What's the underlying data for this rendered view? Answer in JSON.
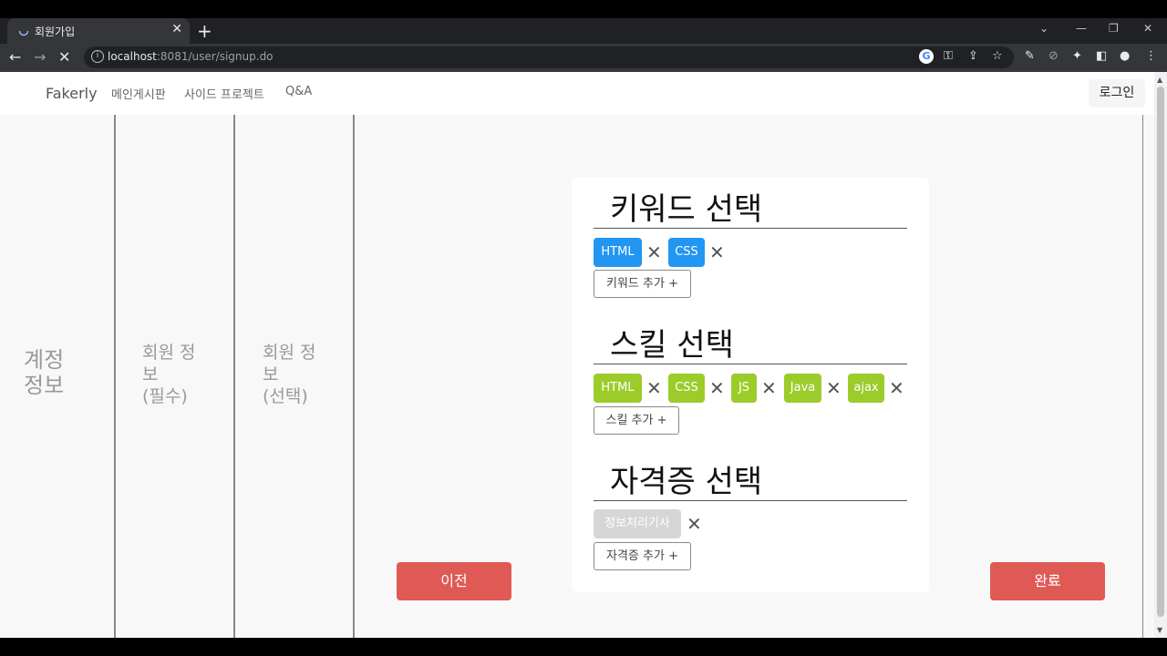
{
  "browser": {
    "tab_title": "회원가입",
    "tab_close": "✕",
    "new_tab": "+",
    "url_host": "localhost",
    "url_rest": ":8081/user/signup.do"
  },
  "nav": {
    "brand": "Fakerly",
    "links": [
      "메인게시판",
      "사이드 프로젝트",
      "Q&A"
    ],
    "login": "로그인"
  },
  "steps": {
    "step1": [
      "계정",
      "정보"
    ],
    "step2": [
      "회원 정",
      "보",
      "(필수)"
    ],
    "step3": [
      "회원 정",
      "보",
      "(선택)"
    ]
  },
  "keyword": {
    "title": "키워드 선택",
    "chips": [
      "HTML",
      "CSS"
    ],
    "add": "키워드 추가 +"
  },
  "skill": {
    "title": "스킬 선택",
    "chips": [
      "HTML",
      "CSS",
      "JS",
      "Java",
      "ajax"
    ],
    "add": "스킬 추가 +"
  },
  "cert": {
    "title": "자격증 선택",
    "chips": [
      "정보처리기사"
    ],
    "add": "자격증 추가 +"
  },
  "remove_glyph": "✕",
  "buttons": {
    "prev": "이전",
    "done": "완료"
  },
  "colors": {
    "keyword_chip": "#2196f3",
    "skill_chip": "#9ccc2a",
    "cert_chip": "#d6d6d6",
    "action_button": "#e05a55"
  }
}
